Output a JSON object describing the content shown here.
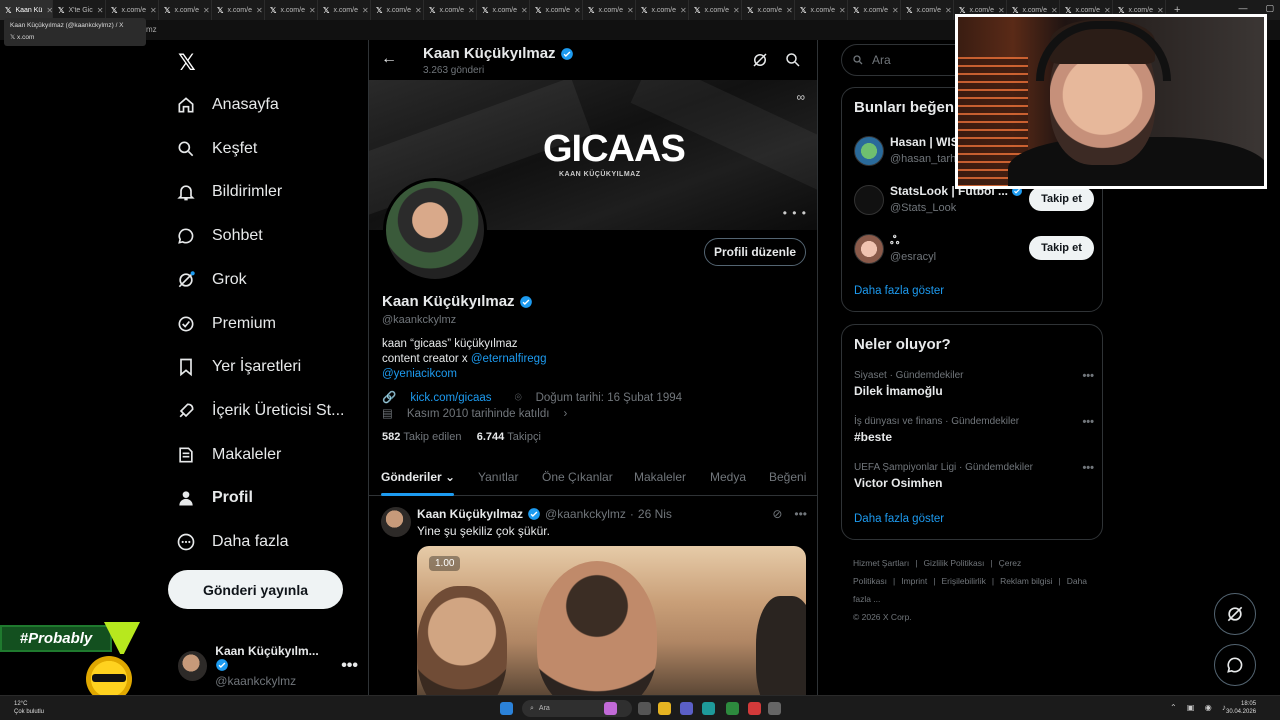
{
  "browser": {
    "tabs": [
      {
        "label": "Kaan Kü",
        "active": true
      },
      {
        "label": "X'te Gic",
        "active": false
      },
      {
        "label": "x.com/e",
        "active": false
      },
      {
        "label": "x.com/e",
        "active": false
      },
      {
        "label": "x.com/e",
        "active": false
      },
      {
        "label": "x.com/e",
        "active": false
      },
      {
        "label": "x.com/e",
        "active": false
      },
      {
        "label": "x.com/e",
        "active": false
      },
      {
        "label": "x.com/e",
        "active": false
      },
      {
        "label": "x.com/e",
        "active": false
      },
      {
        "label": "x.com/e",
        "active": false
      },
      {
        "label": "x.com/e",
        "active": false
      },
      {
        "label": "x.com/e",
        "active": false
      },
      {
        "label": "x.com/e",
        "active": false
      },
      {
        "label": "x.com/e",
        "active": false
      },
      {
        "label": "x.com/e",
        "active": false
      },
      {
        "label": "x.com/e",
        "active": false
      },
      {
        "label": "x.com/e",
        "active": false
      },
      {
        "label": "x.com/e",
        "active": false
      },
      {
        "label": "x.com/e",
        "active": false
      },
      {
        "label": "x.com/e",
        "active": false
      },
      {
        "label": "x.com/e",
        "active": false
      }
    ],
    "tooltip_title": "Kaan Küçükyılmaz (@kaankckylmz) / X",
    "tooltip_domain": "x.com",
    "address_fragment": "mz"
  },
  "nav": {
    "logo": "𝕏",
    "items": [
      {
        "label": "Anasayfa",
        "icon": "home-icon"
      },
      {
        "label": "Keşfet",
        "icon": "search-icon"
      },
      {
        "label": "Bildirimler",
        "icon": "bell-icon"
      },
      {
        "label": "Sohbet",
        "icon": "chat-icon"
      },
      {
        "label": "Grok",
        "icon": "grok-icon"
      },
      {
        "label": "Premium",
        "icon": "premium-icon"
      },
      {
        "label": "Yer İşaretleri",
        "icon": "bookmark-icon"
      },
      {
        "label": "İçerik Üreticisi St...",
        "icon": "rocket-icon"
      },
      {
        "label": "Makaleler",
        "icon": "article-icon"
      },
      {
        "label": "Profil",
        "icon": "person-icon"
      },
      {
        "label": "Daha fazla",
        "icon": "more-circle-icon"
      }
    ],
    "post_button": "Gönderi yayınla",
    "account": {
      "name": "Kaan Küçükyılm...",
      "handle": "@kaankckylmz",
      "more": "•••"
    }
  },
  "profile": {
    "header_name": "Kaan Küçükyılmaz",
    "post_count": "3.263 gönderi",
    "banner_title": "GICAAS",
    "banner_subtitle": "KAAN KÜÇÜKYILMAZ",
    "banner_more": "• • •",
    "edit_button": "Profili düzenle",
    "name": "Kaan Küçükyılmaz",
    "handle": "@kaankckylmz",
    "bio_line1": "kaan “gicaas” küçükyılmaz",
    "bio_line2_prefix": "content creator x ",
    "bio_line2_link": "@eternalfiregg",
    "bio_line3_link": "@yeniacikcom",
    "website": "kick.com/gicaas",
    "birthday": "Doğum tarihi: 16 Şubat 1994",
    "joined": "Kasım 2010 tarihinde katıldı",
    "following_count": "582",
    "following_label": "Takip edilen",
    "followers_count": "6.744",
    "followers_label": "Takipçi",
    "tabs": [
      "Gönderiler",
      "Yanıtlar",
      "Öne Çıkanlar",
      "Makaleler",
      "Medya",
      "Beğeni"
    ]
  },
  "tweet": {
    "name": "Kaan Küçükyılmaz",
    "handle": "@kaankckylmz",
    "sep": "·",
    "date": "26 Nis",
    "more": "•••",
    "text": "Yine şu şekiliz çok şükür.",
    "media_stamp": "1.00"
  },
  "right": {
    "search_placeholder": "Ara",
    "suggest_title": "Bunları beğen",
    "suggestions": [
      {
        "name": "Hasan | WISI",
        "handle": "@hasan_tarh",
        "button": ""
      },
      {
        "name": "StatsLook | Futbol ...",
        "handle": "@Stats_Look",
        "button": "Takip et"
      },
      {
        "name": "ஃ",
        "handle": "@esracyl",
        "button": "Takip et"
      }
    ],
    "suggest_more": "Daha fazla göster",
    "trends_title": "Neler oluyor?",
    "trends": [
      {
        "category": "Siyaset · Gündemdekiler",
        "title": "Dilek İmamoğlu"
      },
      {
        "category": "İş dünyası ve finans · Gündemdekiler",
        "title": "#beste"
      },
      {
        "category": "UEFA Şampiyonlar Ligi · Gündemdekiler",
        "title": "Victor Osimhen"
      }
    ],
    "trends_more": "Daha fazla göster",
    "footer_links": [
      "Hizmet Şartları",
      "Gizlilik Politikası",
      "Çerez Politikası",
      "Imprint",
      "Erişilebilirlik",
      "Reklam bilgisi",
      "Daha fazla ..."
    ],
    "copyright": "© 2026 X Corp."
  },
  "overlay": {
    "badge_text": "#Probably"
  },
  "taskbar": {
    "temp": "12°C",
    "weather": "Çok bulutlu",
    "search": "Ara",
    "time": "18:05",
    "date": "30.04.2026"
  },
  "colors": {
    "accent": "#1d9bf0",
    "background": "#000000",
    "border": "#2f3336",
    "muted": "#71767b"
  }
}
